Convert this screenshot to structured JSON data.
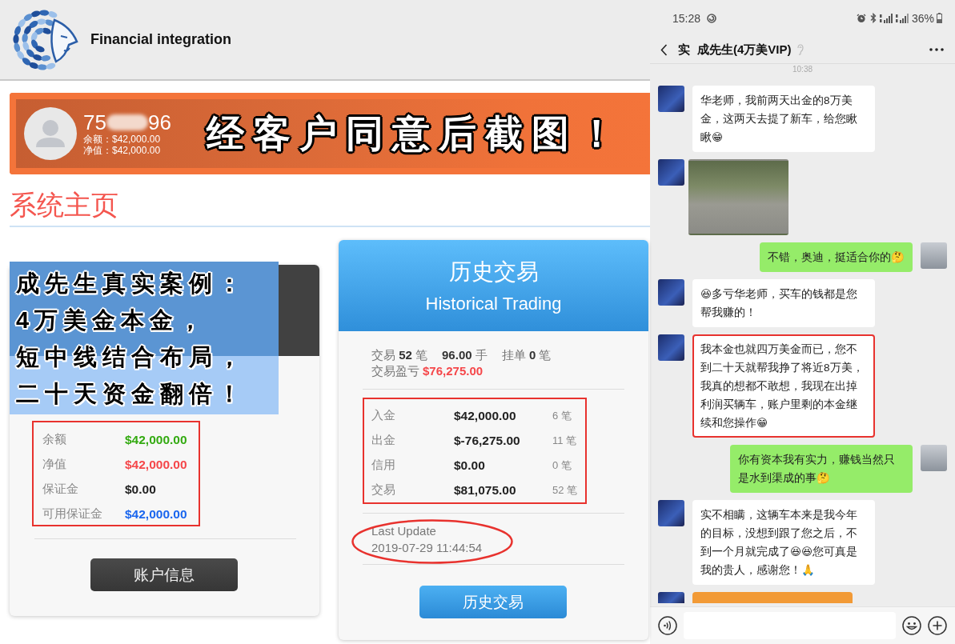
{
  "site_header": {
    "title": "Financial integration"
  },
  "account_banner": {
    "account_start": "75",
    "account_end": "96",
    "redacted": true,
    "lines": [
      "余额：$42,000.00",
      "净值：$42,000.00"
    ],
    "caption": "经客户同意后截图！"
  },
  "page_title": "系统主页",
  "account_card": {
    "caption_lines": [
      "成先生真实案例：",
      "4万美金本金，",
      "短中线结合布局，",
      "二十天资金翻倍！"
    ],
    "boxed": true,
    "rows": [
      {
        "label": "余额",
        "value": "$42,000.00",
        "color": "#33aa11"
      },
      {
        "label": "净值",
        "value": "$42,000.00",
        "color": "#f5474a"
      },
      {
        "label": "保证金",
        "value": "$0.00",
        "color": "#222222"
      },
      {
        "label": "可用保证金",
        "value": "$42,000.00",
        "color": "#1a66ee"
      }
    ],
    "button": "账户信息"
  },
  "history_card": {
    "title": "历史交易",
    "subtitle": "Historical Trading",
    "summary": [
      "交易 **52** 笔",
      "**96.00** 手",
      "挂单 **0** 笔"
    ],
    "pnl_label": "交易盈亏",
    "pnl_value": "$76,275.00",
    "boxed": true,
    "rows": [
      {
        "label": "入金",
        "amount": "$42,000.00",
        "count": "6 笔"
      },
      {
        "label": "出金",
        "amount": "$-76,275.00",
        "count": "11 笔"
      },
      {
        "label": "信用",
        "amount": "$0.00",
        "count": "0 笔"
      },
      {
        "label": "交易",
        "amount": "$81,075.00",
        "count": "52 笔"
      }
    ],
    "update_label": "Last Update",
    "update_time": "2019-07-29 11:44:54",
    "update_circled": true,
    "button": "历史交易"
  },
  "phone": {
    "status_bar": {
      "time": "15:28",
      "battery": "36%"
    },
    "chat_header": {
      "tag": "实",
      "title": "成先生(4万美VIP)"
    },
    "timestamp": "10:38",
    "messages": [
      {
        "outgoing": false,
        "kind": "text",
        "highlighted": false,
        "text": "华老师，我前两天出金的8万美金，这两天去提了新车，给您瞅瞅😁"
      },
      {
        "outgoing": false,
        "kind": "photo",
        "highlighted": false
      },
      {
        "outgoing": true,
        "kind": "text",
        "highlighted": false,
        "text": "不错，奥迪，挺适合你的🤔"
      },
      {
        "outgoing": false,
        "kind": "text",
        "highlighted": false,
        "text": "😆多亏华老师，买车的钱都是您帮我赚的！"
      },
      {
        "outgoing": false,
        "kind": "text",
        "highlighted": true,
        "text": "我本金也就四万美金而已，您不到二十天就帮我挣了将近8万美，我真的想都不敢想，我现在出掉利润买辆车，账户里剩的本金继续和您操作😁"
      },
      {
        "outgoing": true,
        "kind": "text",
        "highlighted": false,
        "text": "你有资本我有实力，赚钱当然只是水到渠成的事🤔"
      },
      {
        "outgoing": false,
        "kind": "text",
        "highlighted": false,
        "text": "实不相瞒，这辆车本来是我今年的目标，没想到跟了您之后，不到一个月就完成了😆😆您可真是我的贵人，感谢您！🙏"
      },
      {
        "outgoing": false,
        "kind": "transfer",
        "highlighted": false
      }
    ]
  }
}
